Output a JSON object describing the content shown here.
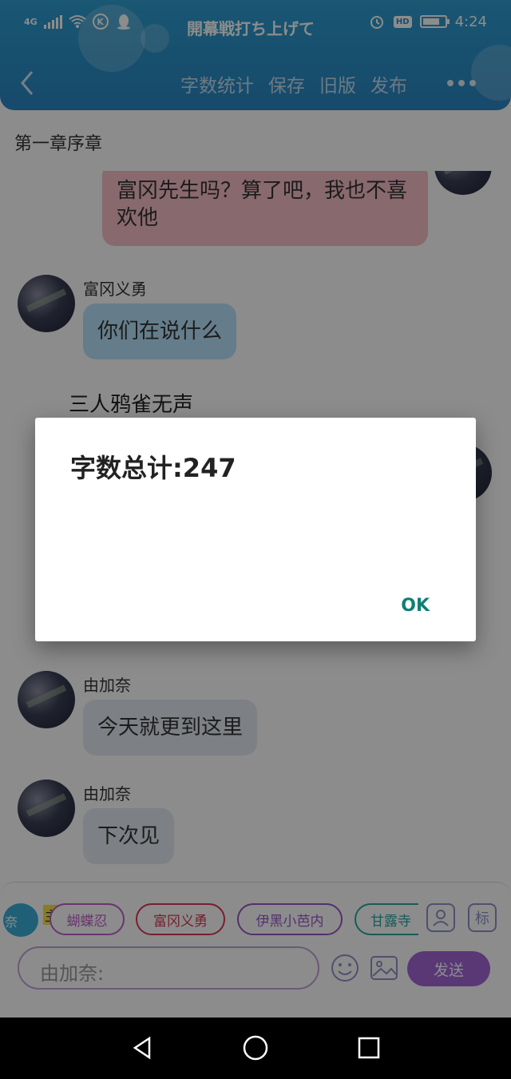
{
  "status_bar": {
    "network": "4G",
    "title": "開幕戦打ち上げて",
    "hd": "HD",
    "time": "4:24"
  },
  "toolbar": {
    "items": [
      "字数统计",
      "保存",
      "旧版",
      "发布"
    ]
  },
  "chapter": {
    "title": "第一章序章"
  },
  "messages": [
    {
      "text": "富冈先生吗？算了吧，我也不喜欢他",
      "color": "#f7c0c8"
    },
    {
      "sender": "富冈义勇",
      "text": "你们在说什么",
      "color": "#b9e4fb"
    },
    {
      "narration": "三人鸦雀无声"
    },
    {
      "sender": "由加奈",
      "text": "今天就更到这里",
      "color": "#e3e9f1"
    },
    {
      "sender": "由加奈",
      "text": "下次见",
      "color": "#e3e9f1"
    }
  ],
  "panel": {
    "role_ring_label": "奈",
    "main_tag": "主",
    "chips": [
      {
        "label": "蝴蝶忍",
        "color": "#c060c8"
      },
      {
        "label": "富冈义勇",
        "color": "#d93a56"
      },
      {
        "label": "伊黑小芭内",
        "color": "#9a58c8"
      },
      {
        "label": "甘露寺",
        "color": "#2aa8a2"
      }
    ],
    "tag_button": "标",
    "input_value": "由加奈:",
    "send_label": "发送"
  },
  "dialog": {
    "message": "字数总计:247",
    "ok_label": "OK"
  }
}
